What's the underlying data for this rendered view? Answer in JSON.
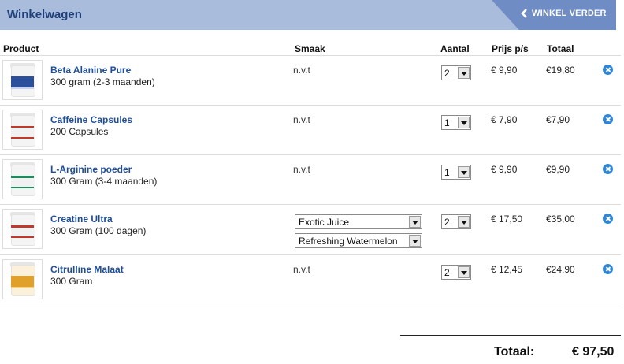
{
  "header": {
    "title": "Winkelwagen",
    "back_label": "WINKEL VERDER",
    "bar_color": "#a9bcdc",
    "button_color": "#6f8cc4"
  },
  "columns": {
    "product": "Product",
    "smaak": "Smaak",
    "aantal": "Aantal",
    "prijs": "Prijs p/s",
    "totaal": "Totaal"
  },
  "items": [
    {
      "name": "Beta Alanine Pure",
      "description": "300 gram (2-3 maanden)",
      "smaak": "n.v.t",
      "quantity": "2",
      "price": "€ 9,90",
      "total": "€19,80",
      "thumb_icon": "supplement-jar-icon",
      "accent": "#2b4f9a"
    },
    {
      "name": "Caffeine Capsules",
      "description": "200 Capsules",
      "smaak": "n.v.t",
      "quantity": "1",
      "price": "€ 7,90",
      "total": "€7,90",
      "thumb_icon": "supplement-jar-icon",
      "accent": "#c0392b"
    },
    {
      "name": "L-Arginine poeder",
      "description": "300 Gram (3-4 maanden)",
      "smaak": "n.v.t",
      "quantity": "1",
      "price": "€ 9,90",
      "total": "€9,90",
      "thumb_icon": "supplement-jar-icon",
      "accent": "#1f8a5b"
    },
    {
      "name": "Creatine Ultra",
      "description": "300 Gram (100 dagen)",
      "flavors": [
        "Exotic Juice",
        "Refreshing Watermelon"
      ],
      "quantity": "2",
      "price": "€ 17,50",
      "total": "€35,00",
      "thumb_icon": "supplement-jar-icon",
      "accent": "#c0392b"
    },
    {
      "name": "Citrulline Malaat",
      "description": "300 Gram",
      "smaak": "n.v.t",
      "quantity": "2",
      "price": "€ 12,45",
      "total": "€24,90",
      "thumb_icon": "supplement-jar-icon",
      "accent": "#e0a02a"
    }
  ],
  "summary": {
    "label": "Totaal:",
    "value": "€ 97,50"
  },
  "colors": {
    "link": "#1f4e99",
    "remove": "#2f86d6"
  }
}
